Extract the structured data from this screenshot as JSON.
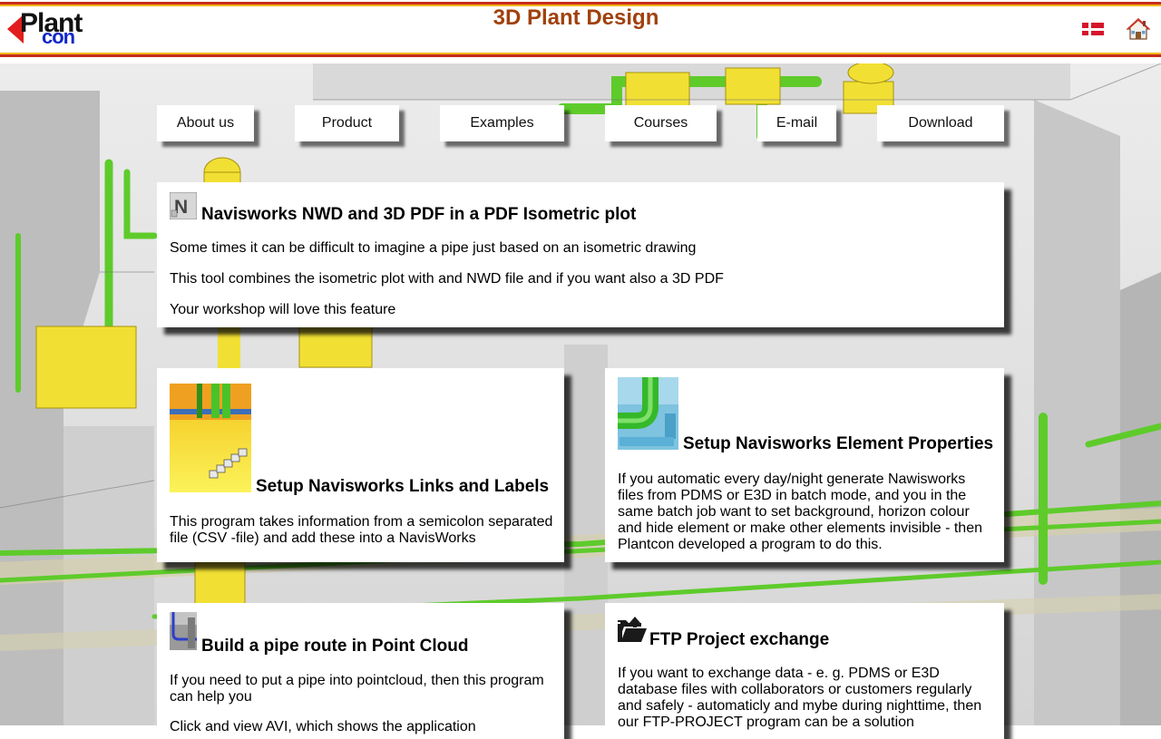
{
  "header": {
    "title": "3D Plant Design",
    "logo_top": "Plant",
    "logo_bottom": "con",
    "flag_icon": "danish-flag-icon",
    "home_icon": "home-icon"
  },
  "nav": [
    {
      "label": "About us"
    },
    {
      "label": "Product"
    },
    {
      "label": "Examples"
    },
    {
      "label": "Courses"
    },
    {
      "label": "E-mail"
    },
    {
      "label": "Download"
    }
  ],
  "articles": {
    "isometric": {
      "title": "Navisworks NWD and 3D PDF in a PDF Isometric plot",
      "icon": "navisworks-icon",
      "paragraphs": [
        "Some times it can be difficult to imagine a pipe just based on an isometric drawing",
        "This tool combines the isometric plot with and NWD file and if you want also a 3D PDF",
        "Your workshop will love this feature"
      ]
    },
    "links_labels": {
      "title": "Setup Navisworks Links and Labels",
      "icon": "links-labels-thumbnail",
      "text": "This program takes information from a semicolon separated file (CSV -file) and add these into a NavisWorks"
    },
    "element_props": {
      "title": "Setup Navisworks Element Properties",
      "icon": "pipe-elbow-thumbnail",
      "text": "If you automatic every day/night generate Nawisworks files from PDMS or E3D in batch mode, and you in the same batch job want to set background, horizon colour and hide element or make other elements invisible - then Plantcon developed a program to do this."
    },
    "pipe_route": {
      "title": "Build a pipe route in Point Cloud",
      "icon": "point-cloud-icon",
      "text": "If you need to put a pipe into pointcloud, then this program can help you",
      "text2": "Click and view AVI, which shows the application"
    },
    "ftp": {
      "title": "FTP Project exchange",
      "icon": "folder-upload-icon",
      "text": "If you want to exchange data - e. g. PDMS or E3D database files with collaborators or customers regularly and safely - automaticly and mybe during nighttime, then our FTP-PROJECT program can be a solution"
    }
  },
  "colors": {
    "title": "#a0410d",
    "header_red": "#c52d1b",
    "header_yellow": "#f3b714",
    "pipe_green": "#5ecb2b",
    "vessel_yellow": "#f1e033"
  }
}
